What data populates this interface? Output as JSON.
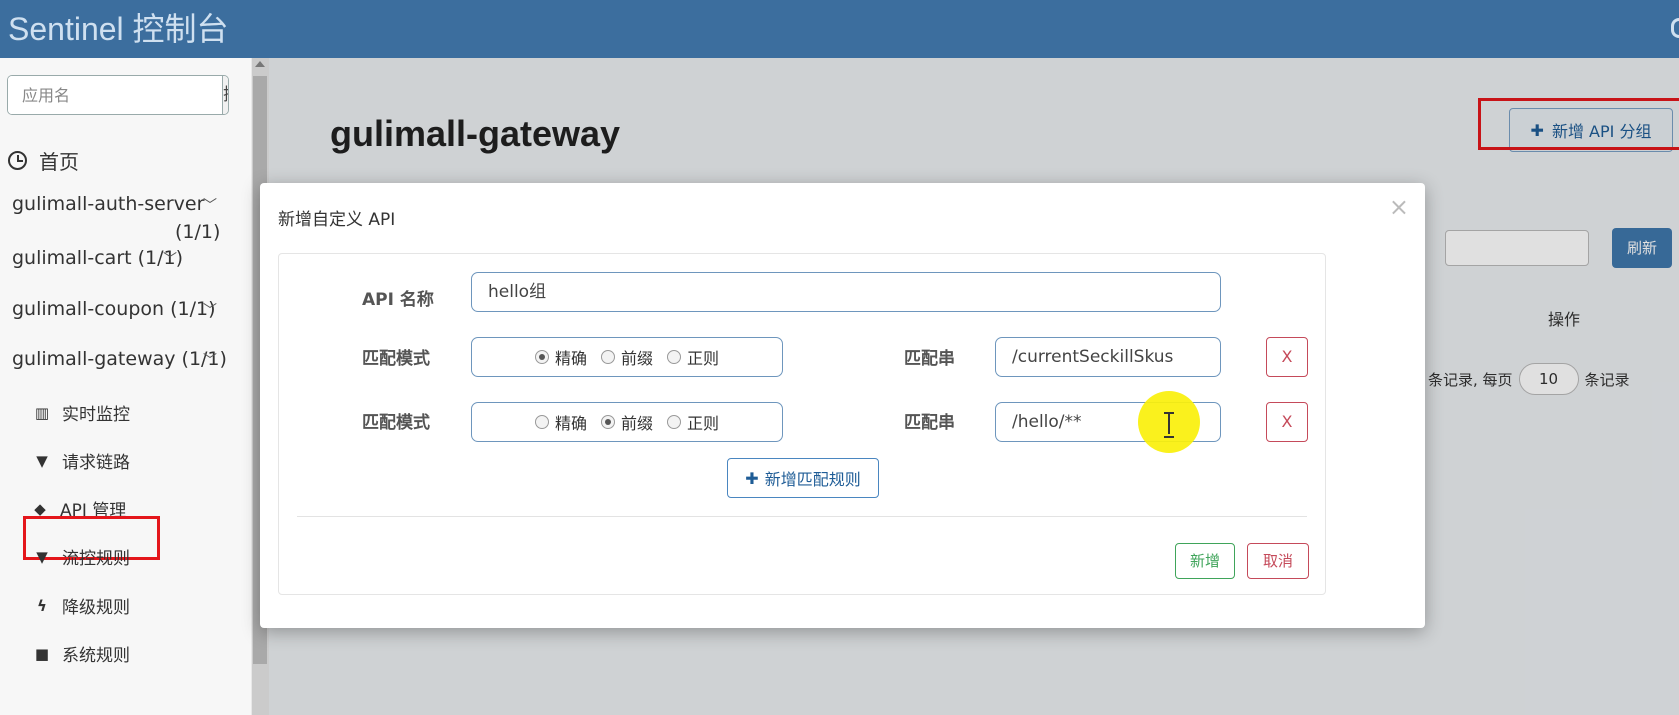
{
  "header": {
    "brand": "Sentinel 控制台"
  },
  "sidebar": {
    "search_placeholder": "应用名",
    "search_button": "搜索",
    "home": "首页",
    "apps": [
      {
        "label": "gulimall-auth-server",
        "count": "(1/1)"
      },
      {
        "label": "gulimall-cart (1/1)"
      },
      {
        "label": "gulimall-coupon  (1/1)"
      },
      {
        "label": "gulimall-gateway  (1/1)"
      }
    ],
    "subitems": [
      {
        "icon": "bar-chart-icon",
        "label": "实时监控"
      },
      {
        "icon": "filter-icon",
        "label": "请求链路"
      },
      {
        "icon": "tags-icon",
        "label": "API 管理"
      },
      {
        "icon": "filter-icon",
        "label": "流控规则"
      },
      {
        "icon": "bolt-icon",
        "label": "降级规则"
      },
      {
        "icon": "lock-icon",
        "label": "系统规则"
      }
    ]
  },
  "main": {
    "title": "gulimall-gateway",
    "add_group_button": "新增 API 分组",
    "refresh_button": "刷新",
    "ops_header": "操作",
    "pager": {
      "prefix": "条记录, 每页",
      "size": "10",
      "suffix": "条记录"
    }
  },
  "modal": {
    "title": "新增自定义 API",
    "name_label": "API 名称",
    "name_value": "hello组",
    "match_mode_label": "匹配模式",
    "match_string_label": "匹配串",
    "mode_options": [
      "精确",
      "前缀",
      "正则"
    ],
    "rules": [
      {
        "selected": "精确",
        "pattern": "/currentSeckillSkus"
      },
      {
        "selected": "前缀",
        "pattern": "/hello/**"
      }
    ],
    "remove_label": "X",
    "add_rule_button": "新增匹配规则",
    "ok_button": "新增",
    "cancel_button": "取消"
  },
  "colors": {
    "header_bg": "#3c6e9e",
    "highlight_red": "#e4161b",
    "cursor_yellow": "#faf00a"
  }
}
